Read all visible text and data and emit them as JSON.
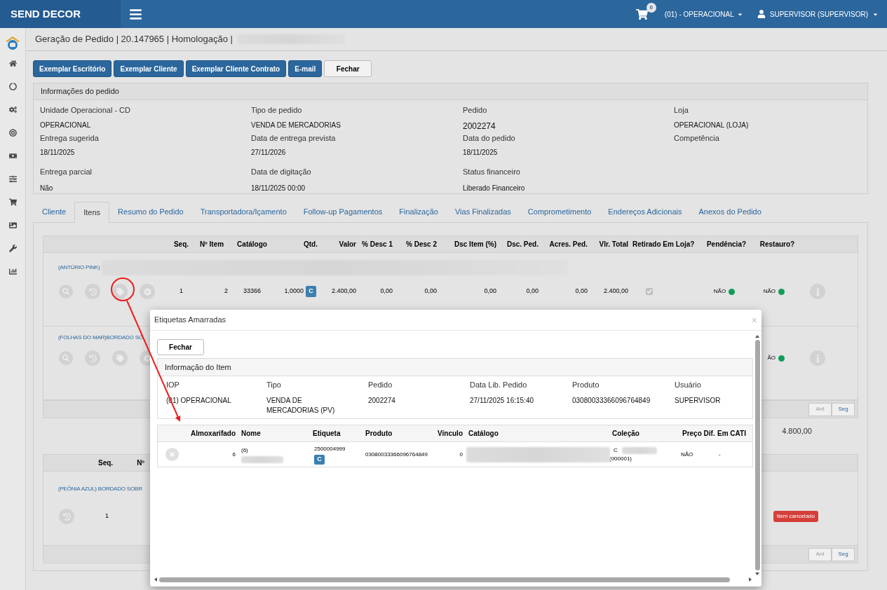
{
  "header": {
    "brand": "SEND DECOR",
    "cart_count": "0",
    "unit": "(01) - OPERACIONAL",
    "user": "SUPERVISOR (SUPERVISOR)"
  },
  "page_title": "Geração de Pedido | 20.147965 | Homologação |",
  "actions": [
    {
      "label": "Exemplar Escritório",
      "kind": "primary"
    },
    {
      "label": "Exemplar Cliente",
      "kind": "primary"
    },
    {
      "label": "Exemplar Cliente Contrato",
      "kind": "primary"
    },
    {
      "label": "E-mail",
      "kind": "primary"
    },
    {
      "label": "Fechar",
      "kind": "default"
    }
  ],
  "order_info": {
    "title": "Informações do pedido",
    "fields": [
      {
        "label": "Unidade Operacional - CD",
        "value": "OPERACIONAL"
      },
      {
        "label": "Tipo de pedido",
        "value": "VENDA DE MERCADORIAS"
      },
      {
        "label": "Pedido",
        "value": "2002274",
        "large": true
      },
      {
        "label": "Loja",
        "value": "OPERACIONAL (LOJA)"
      },
      {
        "label": "Entrega sugerida",
        "value": "18/11/2025"
      },
      {
        "label": "Data de entrega prevista",
        "value": "27/11/2026"
      },
      {
        "label": "Data do pedido",
        "value": "18/11/2025"
      },
      {
        "label": "Competência"
      },
      {
        "label": "Entrega parcial",
        "value": "Não"
      },
      {
        "label": "Data de digitação",
        "value": "18/11/2025 00:00"
      },
      {
        "label": "Status financeiro",
        "value": "Liberado Financeiro"
      }
    ]
  },
  "tabs": [
    {
      "label": "Cliente",
      "selected": false
    },
    {
      "label": "Itens",
      "selected": true
    },
    {
      "label": "Resumo do Pedido",
      "selected": false
    },
    {
      "label": "Transportadora/Içamento",
      "selected": false
    },
    {
      "label": "Follow-up Pagamentos",
      "selected": false
    },
    {
      "label": "Finalização",
      "selected": false
    },
    {
      "label": "Vias Finalizadas",
      "selected": false
    },
    {
      "label": "Comprometimento",
      "selected": false
    },
    {
      "label": "Endereços Adicionais",
      "selected": false
    },
    {
      "label": "Anexos do Pedido",
      "selected": false
    }
  ],
  "items_table": {
    "columns": [
      "Seq.",
      "Nº Item",
      "Catálogo",
      "Qtd.",
      "Valor",
      "% Desc 1",
      "% Desc 2",
      "Dsc Item (%)",
      "Dsc. Ped.",
      "Acres. Ped.",
      "Vlr. Total",
      "Retirado Em Loja?",
      "Pendência?",
      "Restauro?"
    ],
    "rows": [
      {
        "name": "(ANTÚRIO PINK)",
        "seq": "1",
        "item_no": "2",
        "catalog": "33366",
        "qty": "1,0000",
        "qty_badge": "C",
        "valor": "2.400,00",
        "desc1": "0,00",
        "desc2": "0,00",
        "dsc_item": "0,00",
        "dsc_ped": "0,00",
        "acres_ped": "0,00",
        "total": "2.400,00",
        "retirado": {
          "checked": true
        },
        "pendencia": {
          "text": "NÃO",
          "color": "#109d58"
        },
        "restauro": {
          "text": "NÃO",
          "color": "#109d58"
        }
      },
      {
        "name": "(FOLHAS DO MAR)BORDADO SO",
        "restauro": {
          "text": "ÃO",
          "color": "#109d58"
        }
      }
    ],
    "pager": [
      "Ant",
      "Seg"
    ]
  },
  "total": "4.800,00",
  "cancelled_table": {
    "columns": [
      "Seq.",
      "Nº"
    ],
    "rows": [
      {
        "name": "(PEÔNIA AZUL) BORDADO SOBR",
        "seq": "1",
        "status": "Item cancelado"
      }
    ],
    "pager": [
      "Ant",
      "Seg"
    ]
  },
  "modal": {
    "title": "Etiquetas Amarradas",
    "close": "×",
    "button": "Fechar",
    "info": {
      "title": "Informação do Item",
      "fields": [
        {
          "label": "IOP",
          "value": "(01) OPERACIONAL"
        },
        {
          "label": "Tipo",
          "value": "VENDA DE MERCADORIAS (PV)"
        },
        {
          "label": "Pedido",
          "value": "2002274"
        },
        {
          "label": "Data Lib. Pedido",
          "value": "27/11/2025 16:15:40"
        },
        {
          "label": "Produto",
          "value": "03080033366096764849"
        },
        {
          "label": "Usuário",
          "value": "SUPERVISOR"
        }
      ]
    },
    "table": {
      "columns": [
        "Almoxarifado",
        "Nome",
        "Etiqueta",
        "Produto",
        "Vínculo",
        "Catálogo",
        "Coleção",
        "Preço Dif.",
        "Em CATI"
      ],
      "rows": [
        {
          "almoxarifado": "6",
          "nome": "(6)",
          "etiqueta": "2500004999",
          "etiqueta_badge": "C",
          "produto": "03080033366096764849",
          "vinculo": "0",
          "colecao_top": "C",
          "colecao_bottom": "(000001)",
          "preco_dif": "NÃO",
          "em_cati": "-"
        }
      ]
    }
  }
}
